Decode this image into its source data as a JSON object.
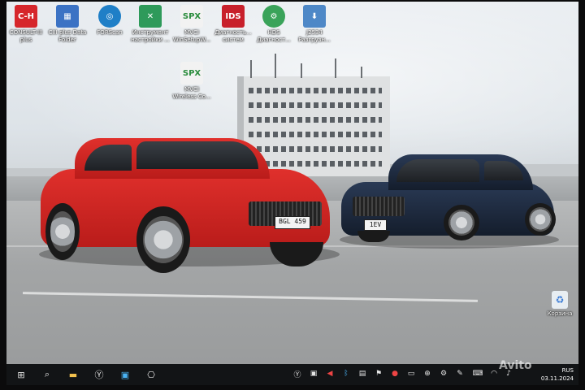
{
  "desktop": {
    "icons": [
      {
        "id": "consult",
        "label": "CONSULT-III\nplus",
        "glyph": "C-H",
        "bg": "#d6262b",
        "fg": "#ffffff",
        "icon": "consult-logo-icon"
      },
      {
        "id": "c3data",
        "label": "CIII plus Data\nFolder",
        "glyph": "▦",
        "bg": "#3b72c4",
        "fg": "#ffffff",
        "icon": "folder-data-icon"
      },
      {
        "id": "porscan",
        "label": "FORScan",
        "glyph": "◎",
        "bg": "#1f7fc7",
        "fg": "#ffffff",
        "icon": "forscan-icon"
      },
      {
        "id": "settings",
        "label": "Инструмент\nнастройки ...",
        "glyph": "✕",
        "bg": "#2e9a5a",
        "fg": "#ffffff",
        "icon": "tool-settings-icon"
      },
      {
        "id": "vcmsetup",
        "label": "MVCI\nWinSetupW...",
        "glyph": "SPX",
        "bg": "#f2f2f2",
        "fg": "#2a8c3c",
        "icon": "spx-icon"
      },
      {
        "id": "idsdiag",
        "label": "Диагность...\nсистем",
        "glyph": "IDS",
        "bg": "#c8202b",
        "fg": "#ffffff",
        "icon": "ids-icon"
      },
      {
        "id": "hds",
        "label": "HDS\nДиагност...",
        "glyph": "⚙",
        "bg": "#3aa35a",
        "fg": "#ffffff",
        "icon": "hds-icon"
      },
      {
        "id": "j2534",
        "label": "J2534\nРазгрузн...",
        "glyph": "⬇",
        "bg": "#4e88c7",
        "fg": "#ffffff",
        "icon": "j2534-icon"
      },
      {
        "id": "mvciwireless",
        "label": "MVCI\nWireless Co...",
        "glyph": "SPX",
        "bg": "#f2f2f2",
        "fg": "#2a8c3c",
        "icon": "spx-icon"
      }
    ],
    "recycle_label": "Корзина"
  },
  "scene": {
    "plate_front_red": "BGL 459",
    "plate_front_blue": "1EV 458"
  },
  "taskbar": {
    "start_icon": "windows-start-icon",
    "clock_time": "RUS",
    "clock_date": "03.11.2024",
    "watermark": "Avito"
  }
}
